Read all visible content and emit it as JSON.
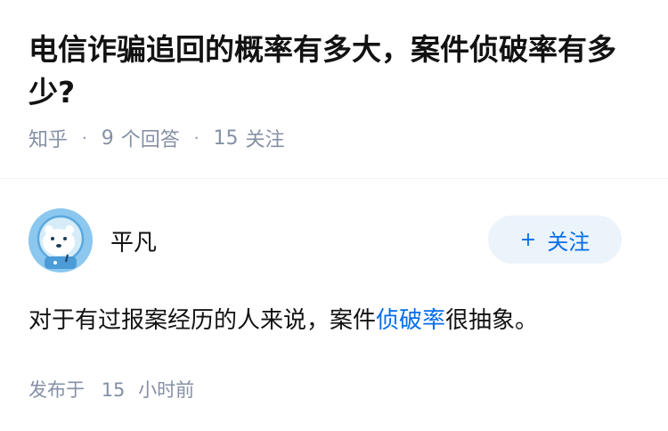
{
  "question": {
    "title": "电信诈骗追回的概率有多大，案件侦破率有多少?",
    "source": "知乎",
    "answer_count": "9",
    "answer_label": "个回答",
    "follow_count": "15",
    "follow_label": "关注"
  },
  "answer": {
    "author": {
      "name": "平凡",
      "avatar_icon": "polar-bear-avatar-icon",
      "avatar_bg": "#8cc7ef"
    },
    "follow_button": {
      "plus": "+",
      "label": "关注"
    },
    "text_before": "对于有过报案经历的人来说，案件",
    "link_text": "侦破率",
    "text_after": "很抽象。",
    "time_prefix": "发布于",
    "time_value": "15",
    "time_unit": "小时前"
  },
  "colors": {
    "primary": "#056de8",
    "meta": "#8590a6",
    "button_bg": "#ebf3fb"
  }
}
